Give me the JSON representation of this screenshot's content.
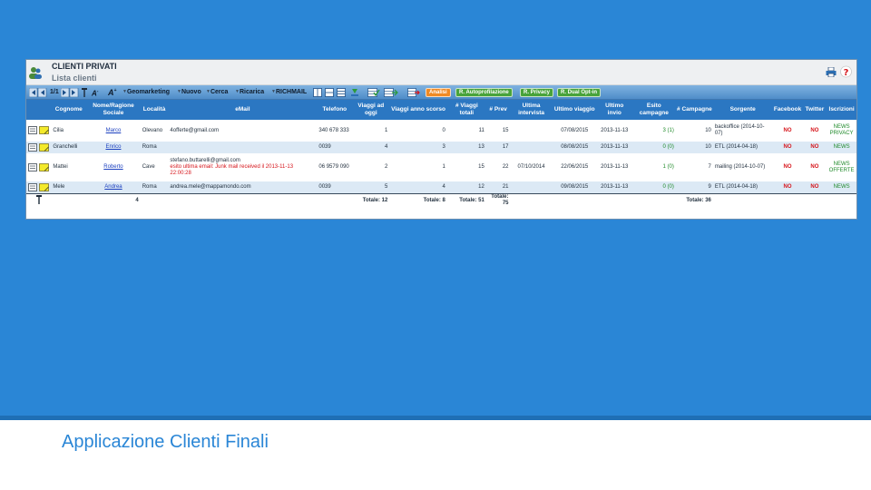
{
  "slide": {
    "caption": "Applicazione Clienti Finali",
    "bg_color": "#2a86d6"
  },
  "app": {
    "title": "CLIENTI PRIVATI",
    "subtitle": "Lista clienti",
    "icons": [
      "users-icon",
      "print-icon",
      "help-icon"
    ]
  },
  "toolbar": {
    "page": "1/1",
    "items": [
      "Geomarketing",
      "Nuovo",
      "Cerca",
      "Ricarica",
      "RICHMAIL"
    ],
    "buttons": [
      "Analisi",
      "R. Autoprofilazione",
      "R. Privacy",
      "R. Dual Opt-in"
    ]
  },
  "columns": [
    "Cognome",
    "Nome/Ragione Sociale",
    "Località",
    "eMail",
    "Telefono",
    "Viaggi ad oggi",
    "Viaggi anno scorso",
    "# Viaggi totali",
    "# Prev",
    "Ultima intervista",
    "Ultimo viaggio",
    "Ultimo invio",
    "Esito campagne",
    "# Campagne",
    "Sorgente",
    "Facebook",
    "Twitter",
    "Iscrizioni"
  ],
  "rows": [
    {
      "cognome": "Cilia",
      "nome": "Marco",
      "localita": "Olevano",
      "email": "4offerte@gmail.com",
      "email_note": "",
      "telefono": "340 678 333",
      "viaggi_oggi": "1",
      "viaggi_anno": "0",
      "viaggi_tot": "11",
      "prev": "15",
      "ultima_int": "",
      "ultimo_viaggio": "07/08/2015",
      "ultimo_invio": "2013-11-13",
      "esito": "3 (1)",
      "campagne": "10",
      "sorgente": "backoffice (2014-10-07)",
      "facebook": "NO",
      "twitter": "NO",
      "iscrizioni": "NEWS PRIVACY"
    },
    {
      "cognome": "Granchelli",
      "nome": "Enrico",
      "localita": "Roma",
      "email": "",
      "email_note": "",
      "telefono": "0039",
      "viaggi_oggi": "4",
      "viaggi_anno": "3",
      "viaggi_tot": "13",
      "prev": "17",
      "ultima_int": "",
      "ultimo_viaggio": "08/08/2015",
      "ultimo_invio": "2013-11-13",
      "esito": "0 (0)",
      "campagne": "10",
      "sorgente": "ETL (2014-04-18)",
      "facebook": "NO",
      "twitter": "NO",
      "iscrizioni": "NEWS"
    },
    {
      "cognome": "Mattei",
      "nome": "Roberto",
      "localita": "Cave",
      "email": "stefano.buttarelli@gmail.com",
      "email_note": "esito ultima email: Junk mail received il 2013-11-13 22:00:28",
      "telefono": "06 9579 090",
      "viaggi_oggi": "2",
      "viaggi_anno": "1",
      "viaggi_tot": "15",
      "prev": "22",
      "ultima_int": "07/10/2014",
      "ultimo_viaggio": "22/06/2015",
      "ultimo_invio": "2013-11-13",
      "esito": "1 (0)",
      "campagne": "7",
      "sorgente": "mailing (2014-10-07)",
      "facebook": "NO",
      "twitter": "NO",
      "iscrizioni": "NEWS OFFERTE"
    },
    {
      "cognome": "Mele",
      "nome": "Andrea",
      "localita": "Roma",
      "email": "andrea.mele@mappamondo.com",
      "email_note": "",
      "telefono": "0039",
      "viaggi_oggi": "5",
      "viaggi_anno": "4",
      "viaggi_tot": "12",
      "prev": "21",
      "ultima_int": "",
      "ultimo_viaggio": "09/08/2015",
      "ultimo_invio": "2013-11-13",
      "esito": "0 (0)",
      "campagne": "9",
      "sorgente": "ETL (2014-04-18)",
      "facebook": "NO",
      "twitter": "NO",
      "iscrizioni": "NEWS"
    }
  ],
  "totals": {
    "count": "4",
    "viaggi_oggi": "Totale: 12",
    "viaggi_anno": "Totale: 8",
    "viaggi_tot": "Totale: 51",
    "prev": "Totale: 75",
    "campagne": "Totale: 36"
  }
}
